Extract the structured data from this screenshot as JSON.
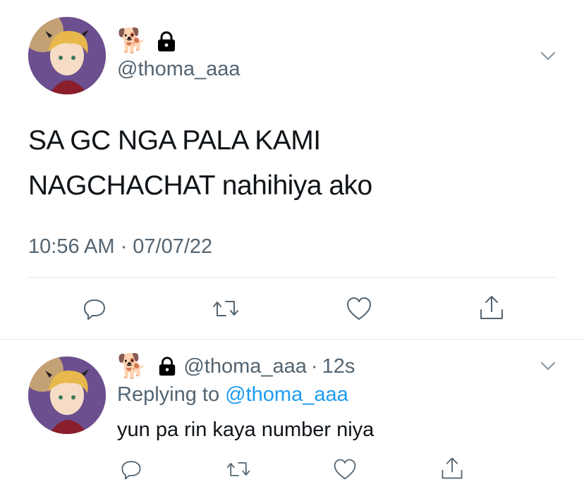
{
  "main_tweet": {
    "name_emoji": "🐕",
    "handle": "@thoma_aaa",
    "text_line1": "SA GC NGA PALA KAMI",
    "text_line2": "NAGCHACHAT nahihiya ako",
    "timestamp": "10:56 AM · 07/07/22"
  },
  "reply_tweet": {
    "name_emoji": "🐕",
    "handle": "@thoma_aaa",
    "separator": "·",
    "time_ago": "12s",
    "replying_prefix": "Replying to",
    "replying_handle": "@thoma_aaa",
    "text": "yun pa rin kaya number niya"
  },
  "icons": {
    "lock": "lock-icon",
    "more": "chevron-down-icon",
    "reply": "reply-icon",
    "retweet": "retweet-icon",
    "like": "heart-icon",
    "share": "share-icon"
  },
  "colors": {
    "text": "#0f1419",
    "secondary": "#536471",
    "link": "#1d9bf0",
    "divider": "#e1e8ed"
  }
}
